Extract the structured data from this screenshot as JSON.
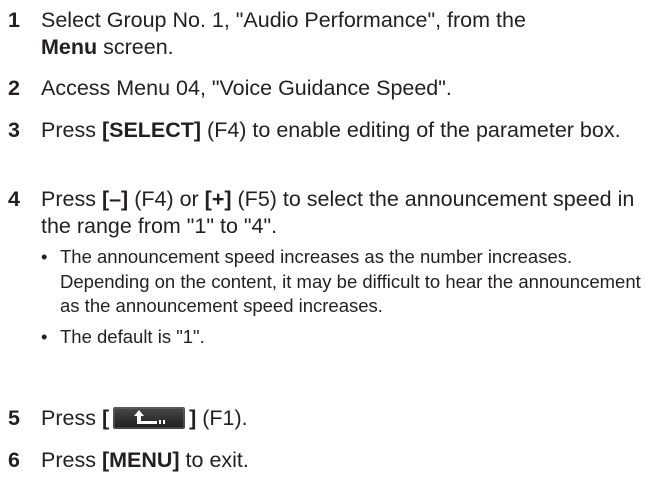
{
  "steps": [
    {
      "num": "1",
      "parts": [
        "Select Group No. 1, \"Audio Performance\", from the",
        "Menu",
        " screen."
      ]
    },
    {
      "num": "2",
      "text": "Access Menu 04, \"Voice Guidance Speed\"."
    },
    {
      "num": "3",
      "parts": [
        "Press ",
        "[SELECT]",
        " (F4) to enable editing of the parameter box."
      ]
    },
    {
      "num": "4",
      "parts": [
        "Press ",
        "[–]",
        " (F4) or ",
        "[+]",
        " (F5) to select the announcement speed in the range from \"1\" to \"4\"."
      ],
      "bullets": [
        "The announcement speed increases as the number increases. Depending on the content, it may be difficult to hear the announcement as the announcement speed increases.",
        "The default is \"1\"."
      ]
    },
    {
      "num": "5",
      "parts": [
        "Press ",
        "[",
        "]",
        " (F1)."
      ],
      "icon": "back-arrow-key-icon"
    },
    {
      "num": "6",
      "parts": [
        "Press ",
        "[MENU]",
        " to exit."
      ]
    }
  ]
}
